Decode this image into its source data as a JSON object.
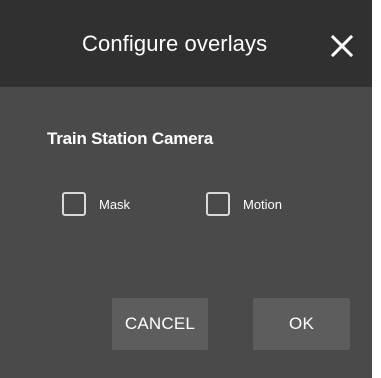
{
  "dialog": {
    "title": "Configure overlays",
    "close_icon": "close-icon"
  },
  "camera": {
    "name": "Train Station Camera"
  },
  "overlays": [
    {
      "label": "Mask",
      "checked": false
    },
    {
      "label": "Motion",
      "checked": false
    }
  ],
  "actions": {
    "cancel_label": "CANCEL",
    "ok_label": "OK"
  },
  "colors": {
    "titlebar": "#303030",
    "body": "#4a4a4a",
    "button": "#5d5d5d",
    "text": "#ffffff"
  }
}
